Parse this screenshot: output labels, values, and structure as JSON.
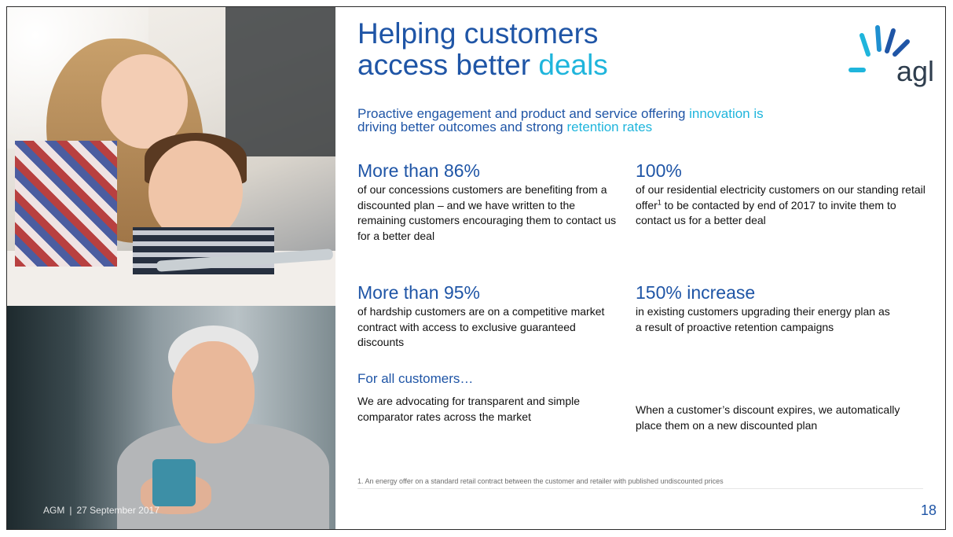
{
  "slide": {
    "title_line1": "Helping customers",
    "title_line2_a": "access better ",
    "title_line2_b": "deals",
    "logo_text": "agl",
    "subtitle_a": "Proactive engagement and product and service offering ",
    "subtitle_b": "innovation is",
    "subtitle_c": "driving better outcomes and strong ",
    "subtitle_d": "retention rates",
    "stats": [
      {
        "headline": "More than 86%",
        "body": "of our concessions customers are benefiting from a discounted plan – and we have written to the remaining customers encouraging them to contact us for a better deal"
      },
      {
        "headline": "100%",
        "body_a": "of our residential electricity customers on our standing retail offer",
        "sup": "1",
        "body_b": " to be contacted by end of 2017 to invite them to contact us for a better deal"
      },
      {
        "headline": "More than 95%",
        "body": "of hardship customers are on a competitive market contract with access to exclusive guaranteed discounts"
      },
      {
        "headline": "150% increase",
        "body": "in existing customers upgrading their energy plan as a result of proactive retention campaigns"
      }
    ],
    "all_customers": {
      "heading": "For all customers…",
      "left": "We are advocating for transparent and simple comparator rates across the market",
      "right": "When a customer’s discount expires, we automatically place them on a new discounted plan"
    },
    "footnote": "1.  An energy offer on a standard retail contract between the customer and retailer with published undiscounted prices",
    "footer": {
      "event": "AGM",
      "separator": "|",
      "date": "27 September 2017"
    },
    "page_number": "18"
  },
  "colors": {
    "primary_blue": "#1f55a6",
    "accent_cyan": "#1fb5dc",
    "text": "#111111"
  }
}
